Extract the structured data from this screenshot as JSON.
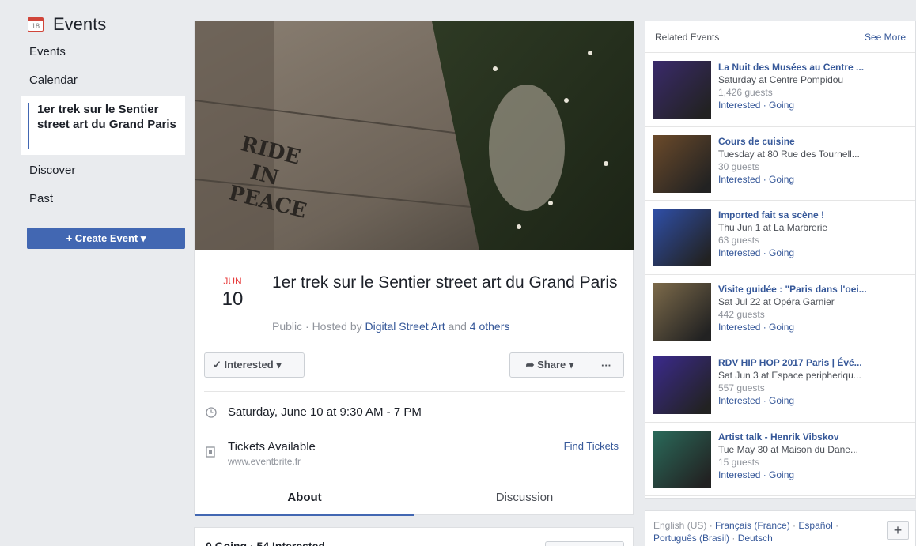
{
  "nav": {
    "calendar_icon_day": "18",
    "title": "Events",
    "items": [
      {
        "label": "Events"
      },
      {
        "label": "Calendar"
      },
      {
        "label": "1er trek sur le Sentier street art du Grand Paris"
      },
      {
        "label": "Discover"
      },
      {
        "label": "Past"
      }
    ],
    "create_button": "+ Create Event ▾"
  },
  "cover": {
    "wall_text": [
      "RIDE",
      "IN",
      "PEACE"
    ]
  },
  "event": {
    "month": "JUN",
    "day": "10",
    "title": "1er trek sur le Sentier street art du Grand Paris",
    "privacy": "Public · Hosted by ",
    "host": "Digital Street Art",
    "and": " and ",
    "others": "4 others",
    "interested_button": "✓ Interested ▾",
    "share_button": "➦ Share ▾",
    "more_button": "···",
    "datetime": "Saturday, June 10 at 9:30 AM - 7 PM",
    "tickets_label": "Tickets Available",
    "tickets_site": "www.eventbrite.fr",
    "find_tickets": "Find Tickets",
    "tabs": [
      {
        "label": "About"
      },
      {
        "label": "Discussion"
      }
    ],
    "going_summary": "0 Going · 54 Interested"
  },
  "related": {
    "header": "Related Events",
    "see_more": "See More",
    "items": [
      {
        "title": "La Nuit des Musées au Centre ...",
        "sub": "Saturday at Centre Pompidou",
        "guests": "1,426 guests",
        "actions": "Interested · Going",
        "color": "#3a2a6b"
      },
      {
        "title": "Cours de cuisine",
        "sub": "Tuesday at 80 Rue des Tournell...",
        "guests": "30 guests",
        "actions": "Interested · Going",
        "color": "#6b4a2a"
      },
      {
        "title": "Imported fait sa scène !",
        "sub": "Thu Jun 1 at La Marbrerie",
        "guests": "63 guests",
        "actions": "Interested · Going",
        "color": "#2f4fa8"
      },
      {
        "title": "Visite guidée : \"Paris dans l'oei...",
        "sub": "Sat Jul 22 at Opéra Garnier",
        "guests": "442 guests",
        "actions": "Interested · Going",
        "color": "#7c6a4a"
      },
      {
        "title": "RDV HIP HOP 2017 Paris | Évé...",
        "sub": "Sat Jun 3 at Espace peripheriqu...",
        "guests": "557 guests",
        "actions": "Interested · Going",
        "color": "#3b2a8c"
      },
      {
        "title": "Artist talk - Henrik Vibskov",
        "sub": "Tue May 30 at Maison du Dane...",
        "guests": "15 guests",
        "actions": "Interested · Going",
        "color": "#2a6a5a"
      }
    ]
  },
  "languages": {
    "current": "English (US) · ",
    "links": [
      "Français (France)",
      "Español",
      "Português (Brasil)",
      "Deutsch"
    ],
    "plus": "+"
  }
}
